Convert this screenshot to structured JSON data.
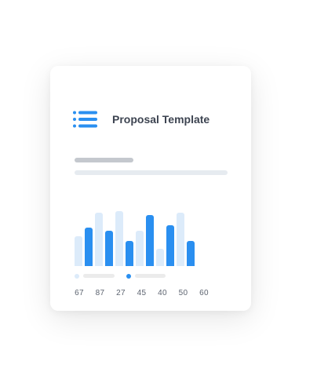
{
  "card": {
    "title": "Proposal Template",
    "icon": "list-icon"
  },
  "colors": {
    "accent": "#2a8ff0",
    "accent_light": "#dcebfa",
    "text": "#3d4451",
    "muted_text": "#5d6470"
  },
  "chart_data": {
    "type": "bar",
    "series": [
      {
        "values": [
          38,
          49,
          68,
          45,
          70,
          32,
          45,
          65,
          22,
          52,
          68,
          32
        ]
      }
    ],
    "bar_colors": [
      "light",
      "dark",
      "light",
      "dark",
      "light",
      "dark",
      "light",
      "dark",
      "light",
      "dark",
      "light",
      "dark"
    ],
    "tick_labels": [
      "67",
      "87",
      "27",
      "45",
      "40",
      "50",
      "60"
    ],
    "legend": [
      {
        "color": "#dcebfa"
      },
      {
        "color": "#2a8ff0"
      }
    ],
    "ylim": [
      0,
      77
    ]
  }
}
